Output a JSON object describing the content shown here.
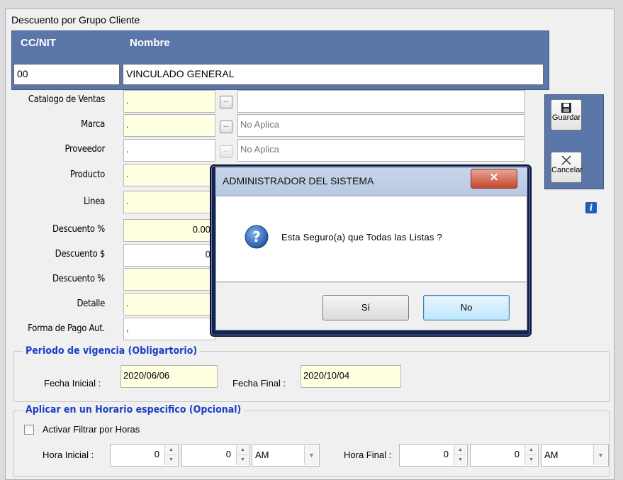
{
  "window": {
    "title": "Descuento por Grupo Cliente"
  },
  "header": {
    "col_id": "CC/NIT",
    "col_name": "Nombre",
    "id_value": "00",
    "name_value": "VINCULADO GENERAL"
  },
  "form": {
    "catalogo": {
      "label": "Catalogo de Ventas",
      "value": ".",
      "desc": ""
    },
    "marca": {
      "label": "Marca",
      "value": ".",
      "desc": "No Aplica"
    },
    "proveedor": {
      "label": "Proveedor",
      "value": ".",
      "desc": "No Aplica"
    },
    "producto": {
      "label": "Producto",
      "value": "."
    },
    "linea": {
      "label": "Linea",
      "value": "."
    },
    "descuento_pct": {
      "label": "Descuento %",
      "value": "0.00"
    },
    "descuento_val": {
      "label": "Descuento $",
      "value": "0"
    },
    "descuento_pct2": {
      "label": "Descuento %",
      "value": ""
    },
    "detalle": {
      "label": "Detalle",
      "value": "."
    },
    "forma_pago": {
      "label": "Forma de Pago Aut.",
      "value": ","
    },
    "browse_label": "..."
  },
  "sidebar": {
    "save_label": "Guardar",
    "cancel_label": "Cancelar",
    "info_glyph": "i"
  },
  "periodo": {
    "title": "Periodo de vigencia  (Obligartorio)",
    "fecha_inicial_label": "Fecha Inicial :",
    "fecha_inicial": "2020/06/06",
    "fecha_final_label": "Fecha Final :",
    "fecha_final": "2020/10/04"
  },
  "horario": {
    "title": "Aplicar en un Horario  especifico  (Opcional)",
    "checkbox_label": "Activar Filtrar por Horas",
    "hora_inicial_label": "Hora Inicial :",
    "hi_h": "0",
    "hi_m": "0",
    "hi_ampm": "AM",
    "hora_final_label": "Hora Final :",
    "hf_h": "0",
    "hf_m": "0",
    "hf_ampm": "AM"
  },
  "dialog": {
    "title": "ADMINISTRADOR DEL SISTEMA",
    "close_glyph": "✕",
    "message": "Esta Seguro(a) que Todas las Listas ?",
    "yes_label": "Sí",
    "no_label": "No",
    "icon": "question-icon"
  },
  "colors": {
    "header_blue": "#5b76a8",
    "field_yellow": "#ffffe1",
    "group_title": "#1a3fc4"
  }
}
